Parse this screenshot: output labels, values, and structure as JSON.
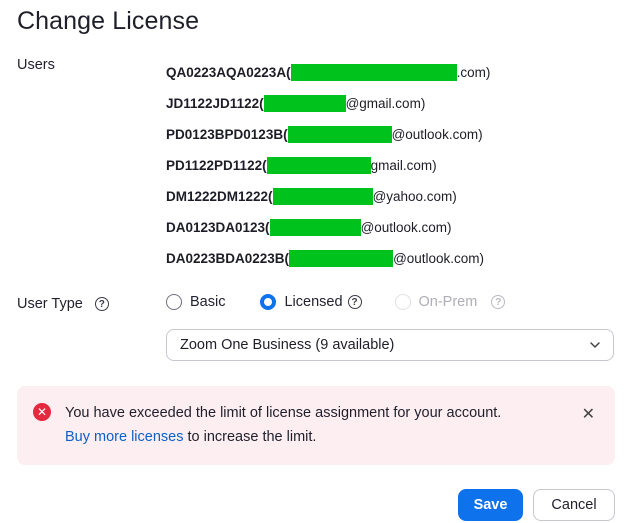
{
  "dialog": {
    "title": "Change License"
  },
  "users_label": "Users",
  "users": [
    {
      "id": "QA0223AQA0223A(",
      "email_suffix": ".com)"
    },
    {
      "id": "JD1122JD1122(",
      "email_suffix": "@gmail.com)"
    },
    {
      "id": "PD0123BPD0123B(",
      "email_suffix": "@outlook.com)"
    },
    {
      "id": "PD1122PD1122(",
      "email_suffix": "gmail.com)"
    },
    {
      "id": "DM1222DM1222(",
      "email_suffix": "@yahoo.com)"
    },
    {
      "id": "DA0123DA0123(",
      "email_suffix": "@outlook.com)"
    },
    {
      "id": "DA0223BDA0223B(",
      "email_suffix": "@outlook.com)"
    }
  ],
  "user_type": {
    "label": "User Type",
    "options": [
      {
        "label": "Basic",
        "state": "unchecked"
      },
      {
        "label": "Licensed",
        "state": "checked"
      },
      {
        "label": "On-Prem",
        "state": "disabled"
      }
    ]
  },
  "plan_select": {
    "value": "Zoom One Business (9 available)"
  },
  "alert": {
    "message": "You have exceeded the limit of license assignment for your account.",
    "link_text": "Buy more licenses",
    "suffix": " to increase the limit."
  },
  "buttons": {
    "save": "Save",
    "cancel": "Cancel"
  },
  "colors": {
    "accent": "#0e72ed",
    "error": "#e5293f",
    "alert_bg": "#fdeff1",
    "redaction": "#00c21d"
  }
}
